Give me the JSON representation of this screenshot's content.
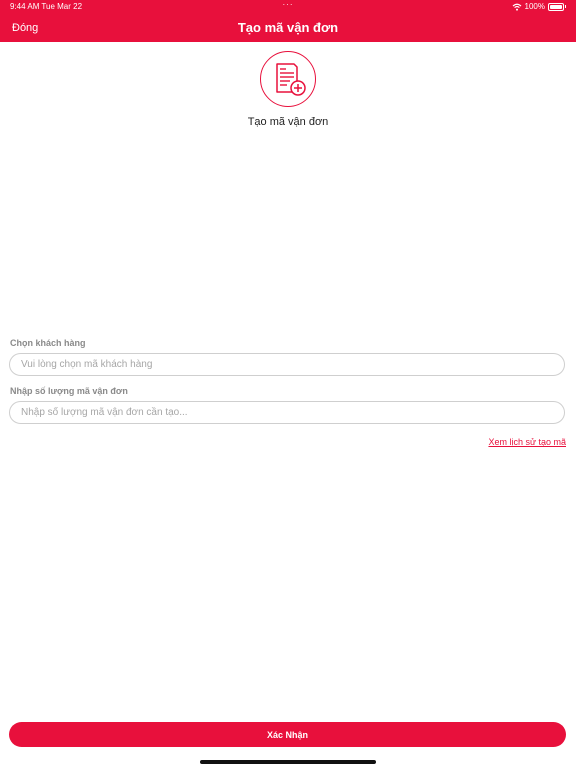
{
  "status_bar": {
    "time": "9:44 AM  Tue Mar 22",
    "dots": "···",
    "battery": "100%"
  },
  "header": {
    "close_label": "Đóng",
    "title": "Tạo mã vận đơn"
  },
  "hero": {
    "icon": "document-add-icon",
    "caption": "Tạo mã vận đơn"
  },
  "customer": {
    "label": "Chọn khách hàng",
    "placeholder": "Vui lòng chọn mã khách hàng",
    "value": ""
  },
  "quantity": {
    "label": "Nhập số lượng mã vận đơn",
    "placeholder": "Nhập số lượng mã vận đơn cần tạo...",
    "value": ""
  },
  "history_link": "Xem lịch sử tạo mã",
  "confirm_label": "Xác Nhận",
  "colors": {
    "brand": "#e8103c",
    "placeholder": "#a6a6a6",
    "label": "#8a8a8a"
  }
}
